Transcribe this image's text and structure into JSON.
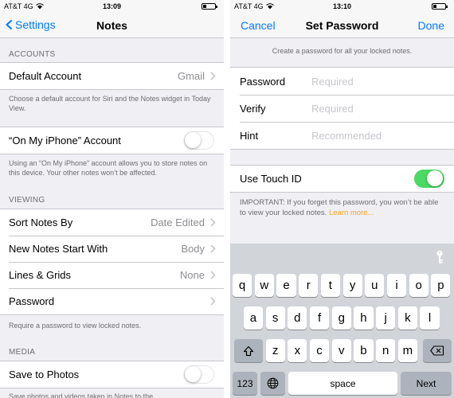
{
  "left": {
    "status": {
      "carrier": "AT&T 4G",
      "time": "13:09"
    },
    "nav": {
      "back": "Settings",
      "title": "Notes"
    },
    "accounts": {
      "header": "ACCOUNTS",
      "default_account": {
        "label": "Default Account",
        "value": "Gmail"
      },
      "footer": "Choose a default account for Siri and the Notes widget in Today View."
    },
    "on_my_iphone": {
      "label": "“On My iPhone” Account",
      "toggle_on": false,
      "footer": "Using an “On My iPhone” account allows you to store notes on this device. Your other notes won’t be affected."
    },
    "viewing": {
      "header": "VIEWING",
      "rows": [
        {
          "label": "Sort Notes By",
          "value": "Date Edited"
        },
        {
          "label": "New Notes Start With",
          "value": "Body"
        },
        {
          "label": "Lines & Grids",
          "value": "None"
        },
        {
          "label": "Password",
          "value": ""
        }
      ],
      "footer": "Require a password to view locked notes."
    },
    "media": {
      "header": "MEDIA",
      "save_to_photos": {
        "label": "Save to Photos",
        "toggle_on": false
      },
      "footer": "Save photos and videos taken in Notes to the"
    }
  },
  "right": {
    "status": {
      "carrier": "AT&T 4G",
      "time": "13:10"
    },
    "nav": {
      "cancel": "Cancel",
      "title": "Set Password",
      "done": "Done"
    },
    "info": "Create a password for all your locked notes.",
    "fields": [
      {
        "label": "Password",
        "placeholder": "Required"
      },
      {
        "label": "Verify",
        "placeholder": "Required"
      },
      {
        "label": "Hint",
        "placeholder": "Recommended"
      }
    ],
    "touch_id": {
      "label": "Use Touch ID",
      "toggle_on": true
    },
    "important": {
      "text": "IMPORTANT: If you forget this password, you won’t be able to view your locked notes. ",
      "link": "Learn more..."
    },
    "keyboard": {
      "row1": [
        "q",
        "w",
        "e",
        "r",
        "t",
        "y",
        "u",
        "i",
        "o",
        "p"
      ],
      "row2": [
        "a",
        "s",
        "d",
        "f",
        "g",
        "h",
        "j",
        "k",
        "l"
      ],
      "row3": [
        "z",
        "x",
        "c",
        "v",
        "b",
        "n",
        "m"
      ],
      "numbers": "123",
      "space": "space",
      "next": "Next",
      "shift_icon": "shift-arrow-icon",
      "delete_icon": "backspace-icon",
      "globe_icon": "globe-icon",
      "password_icon": "key-icon"
    },
    "colors": {
      "accent": "#007aff",
      "toggle_on": "#4cd964",
      "link": "#f5a623"
    }
  }
}
